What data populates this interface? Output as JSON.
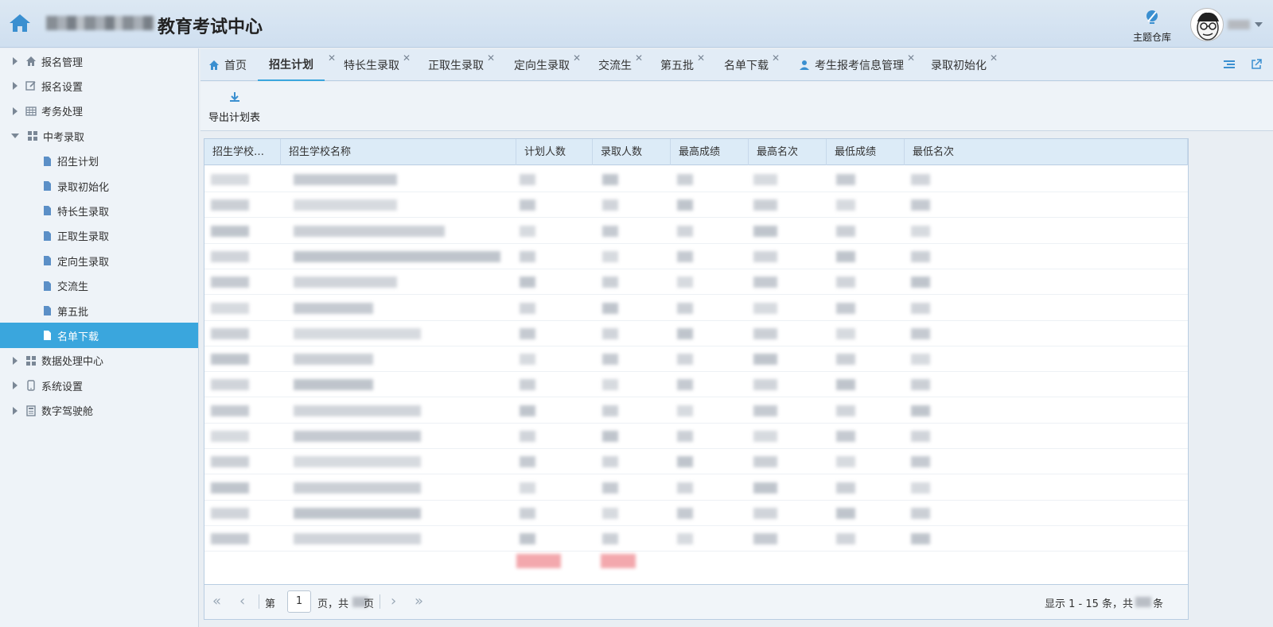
{
  "header": {
    "title": "教育考试中心",
    "theme_label": "主题仓库"
  },
  "sidebar": {
    "items": [
      {
        "label": "报名管理",
        "icon": "home-icon",
        "expanded": false
      },
      {
        "label": "报名设置",
        "icon": "edit-icon",
        "expanded": false
      },
      {
        "label": "考务处理",
        "icon": "table-icon",
        "expanded": false
      },
      {
        "label": "中考录取",
        "icon": "grid-icon",
        "expanded": true
      },
      {
        "label": "招生计划",
        "icon": "file-icon",
        "child": true
      },
      {
        "label": "录取初始化",
        "icon": "file-icon",
        "child": true
      },
      {
        "label": "特长生录取",
        "icon": "file-icon",
        "child": true
      },
      {
        "label": "正取生录取",
        "icon": "file-icon",
        "child": true
      },
      {
        "label": "定向生录取",
        "icon": "file-icon",
        "child": true
      },
      {
        "label": "交流生",
        "icon": "file-icon",
        "child": true
      },
      {
        "label": "第五批",
        "icon": "file-icon",
        "child": true
      },
      {
        "label": "名单下载",
        "icon": "file-icon",
        "child": true,
        "active": true
      },
      {
        "label": "数据处理中心",
        "icon": "grid-icon",
        "expanded": false
      },
      {
        "label": "系统设置",
        "icon": "phone-icon",
        "expanded": false
      },
      {
        "label": "数字驾驶舱",
        "icon": "calculator-icon",
        "expanded": false
      }
    ]
  },
  "tabs": [
    {
      "label": "首页",
      "icon": "home-icon",
      "closable": false
    },
    {
      "label": "招生计划",
      "active": true,
      "closable": true
    },
    {
      "label": "特长生录取",
      "closable": true
    },
    {
      "label": "正取生录取",
      "closable": true
    },
    {
      "label": "定向生录取",
      "closable": true
    },
    {
      "label": "交流生",
      "closable": true
    },
    {
      "label": "第五批",
      "closable": true
    },
    {
      "label": "名单下载",
      "closable": true
    },
    {
      "label": "考生报考信息管理",
      "icon": "user-icon",
      "closable": true
    },
    {
      "label": "录取初始化",
      "closable": true
    }
  ],
  "toolbar": {
    "export_label": "导出计划表"
  },
  "grid": {
    "columns": [
      "招生学校…",
      "招生学校名称",
      "计划人数",
      "录取人数",
      "最高成绩",
      "最高名次",
      "最低成绩",
      "最低名次"
    ],
    "row_count": 15
  },
  "pager": {
    "page_prefix": "第",
    "current_page": "1",
    "page_suffix": "页，共",
    "page_end": "页",
    "display_text": "显示 1 - 15 条，共",
    "display_end": "条"
  },
  "colors": {
    "accent": "#3aa6dd",
    "header_bg": "#dce8f3",
    "grid_head_bg": "#dcebf7"
  }
}
